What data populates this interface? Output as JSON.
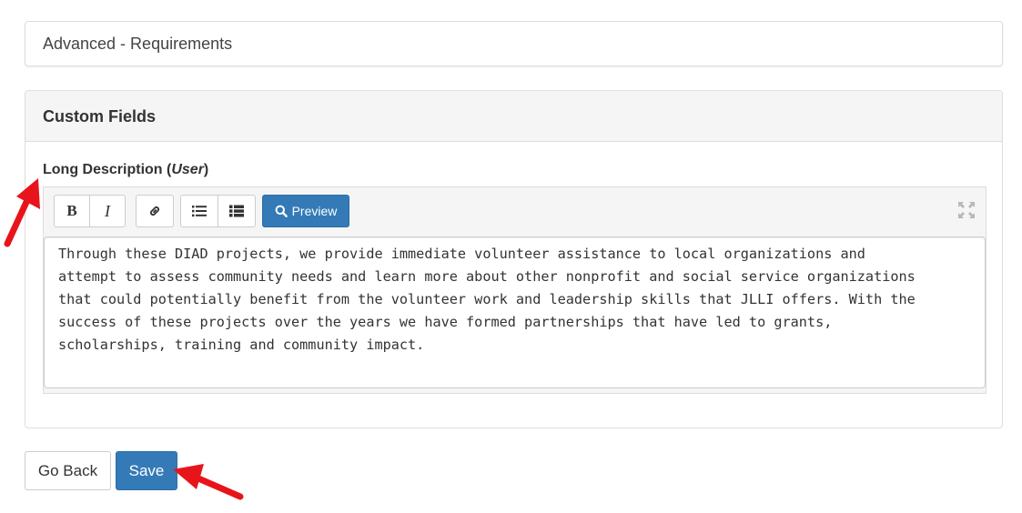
{
  "advanced_panel": {
    "title": "Advanced - Requirements"
  },
  "custom_fields": {
    "title": "Custom Fields",
    "field_label": "Long Description",
    "field_label_prefix": "(",
    "field_label_qualifier": "User",
    "field_label_suffix": ")"
  },
  "editor": {
    "toolbar": {
      "bold_label": "B",
      "italic_label": "I",
      "preview_label": "Preview",
      "icons": [
        "link-icon",
        "unordered-list-icon",
        "ordered-list-icon",
        "search-icon",
        "fullscreen-icon"
      ]
    },
    "value": "Through these DIAD projects, we provide immediate volunteer assistance to local organizations and attempt to assess community needs and learn more about other nonprofit and social service organizations that could potentially benefit from the volunteer work and leadership skills that JLLI offers. With the success of these projects over the years we have formed partnerships that have led to grants, scholarships, training and community impact.",
    "lines": [
      "Through these DIAD projects, we provide immediate volunteer assistance to local organizations and",
      "attempt to assess community needs and learn more about other nonprofit and social service organizations",
      "that could potentially benefit from the volunteer work and leadership skills that JLLI offers. With the",
      "success of these projects over the years we have formed partnerships that have led to grants,",
      "scholarships, training and community impact."
    ]
  },
  "actions": {
    "back_label": "Go Back",
    "save_label": "Save"
  },
  "colors": {
    "primary": "#337ab7",
    "annotation_arrow": "#e8141b",
    "panel_heading_bg": "#f5f5f5",
    "border": "#dddddd"
  }
}
